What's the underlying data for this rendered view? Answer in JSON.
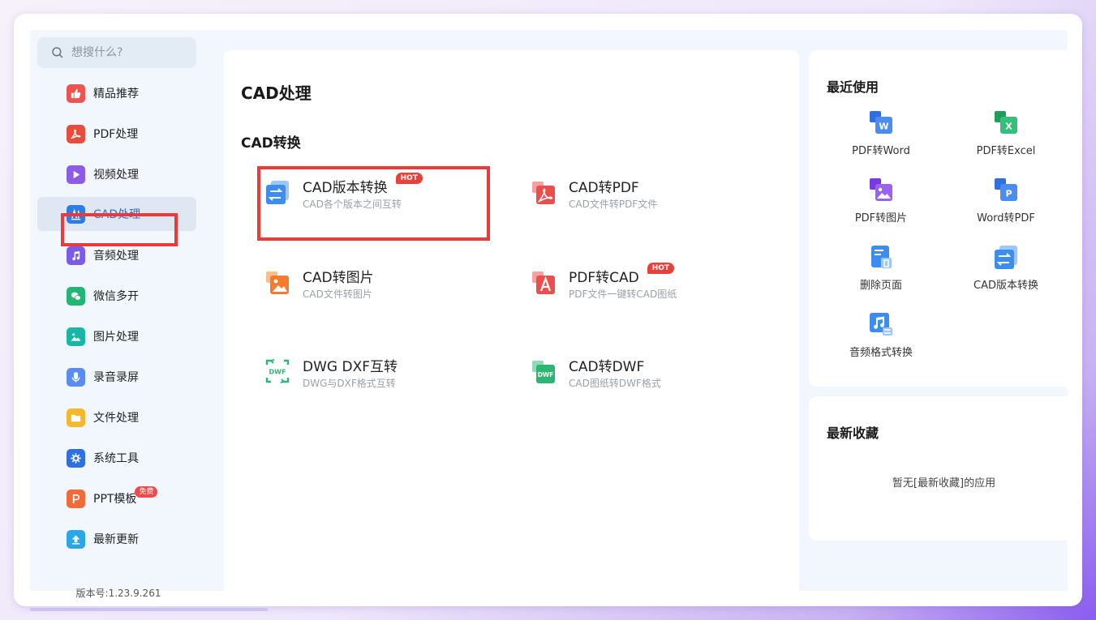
{
  "search": {
    "placeholder": "想搜什么?"
  },
  "sidebar": {
    "items": [
      {
        "label": "精品推荐",
        "icon": "thumbs-up-icon",
        "color": "#ef5350"
      },
      {
        "label": "PDF处理",
        "icon": "pdf-icon",
        "color": "#e84c3d"
      },
      {
        "label": "视频处理",
        "icon": "play-icon",
        "color": "#8e5be8"
      },
      {
        "label": "CAD处理",
        "icon": "cad-icon",
        "color": "#2f7be5"
      },
      {
        "label": "音频处理",
        "icon": "music-icon",
        "color": "#7b5be8"
      },
      {
        "label": "微信多开",
        "icon": "wechat-icon",
        "color": "#22b573"
      },
      {
        "label": "图片处理",
        "icon": "image-icon",
        "color": "#19b5a5"
      },
      {
        "label": "录音录屏",
        "icon": "microphone-icon",
        "color": "#5b8df0"
      },
      {
        "label": "文件处理",
        "icon": "folder-icon",
        "color": "#f5b72b"
      },
      {
        "label": "系统工具",
        "icon": "gear-icon",
        "color": "#2f6fe0"
      },
      {
        "label": "PPT模板",
        "icon": "ppt-icon",
        "color": "#f06a3a",
        "badge": "免费"
      },
      {
        "label": "最新更新",
        "icon": "upload-icon",
        "color": "#2aa7e8"
      }
    ],
    "active_index": 3,
    "version": "版本号:1.23.9.261"
  },
  "main": {
    "title": "CAD处理",
    "section": "CAD转换",
    "hot_label": "HOT",
    "tools": [
      {
        "name": "CAD版本转换",
        "desc": "CAD各个版本之间互转",
        "hot": true,
        "icon": "cad-version-convert-icon"
      },
      {
        "name": "CAD转PDF",
        "desc": "CAD文件转PDF文件",
        "hot": false,
        "icon": "cad-to-pdf-icon"
      },
      {
        "name": "CAD转图片",
        "desc": "CAD文件转图片",
        "hot": false,
        "icon": "cad-to-image-icon"
      },
      {
        "name": "PDF转CAD",
        "desc": "PDF文件一键转CAD图纸",
        "hot": true,
        "icon": "pdf-to-cad-icon"
      },
      {
        "name": "DWG DXF互转",
        "desc": "DWG与DXF格式互转",
        "hot": false,
        "icon": "dwg-dxf-icon"
      },
      {
        "name": "CAD转DWF",
        "desc": "CAD图纸转DWF格式",
        "hot": false,
        "icon": "cad-to-dwf-icon"
      }
    ]
  },
  "recent": {
    "title": "最近使用",
    "items": [
      {
        "label": "PDF转Word",
        "icon": "pdf-to-word-icon"
      },
      {
        "label": "PDF转Excel",
        "icon": "pdf-to-excel-icon"
      },
      {
        "label": "PDF转图片",
        "icon": "pdf-to-image-icon"
      },
      {
        "label": "Word转PDF",
        "icon": "word-to-pdf-icon"
      },
      {
        "label": "删除页面",
        "icon": "delete-page-icon"
      },
      {
        "label": "CAD版本转换",
        "icon": "cad-version-convert-icon"
      },
      {
        "label": "音频格式转换",
        "icon": "audio-convert-icon"
      }
    ]
  },
  "favorites": {
    "title": "最新收藏",
    "empty_text": "暂无[最新收藏]的应用"
  }
}
